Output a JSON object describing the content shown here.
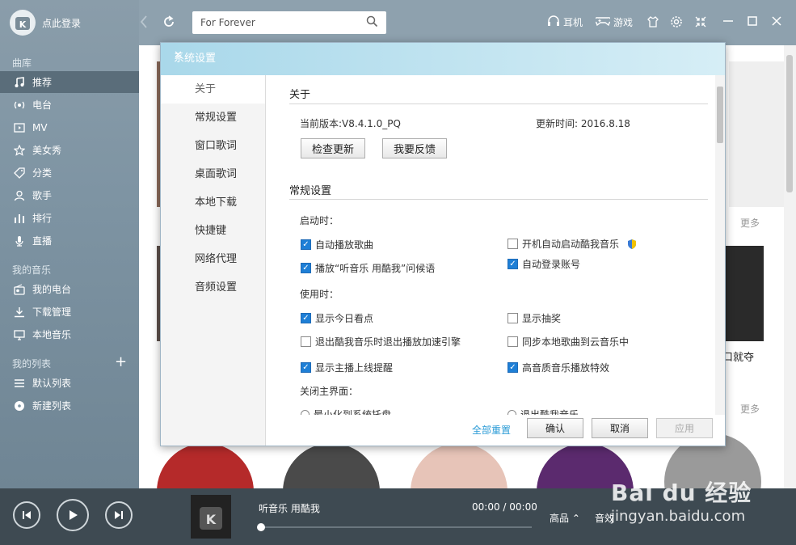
{
  "sidebar": {
    "login_label": "点此登录",
    "sections": [
      {
        "title": "曲库",
        "items": [
          {
            "label": "推荐",
            "icon": "music-note-icon",
            "active": true
          },
          {
            "label": "电台",
            "icon": "radio-icon"
          },
          {
            "label": "MV",
            "icon": "mv-icon"
          },
          {
            "label": "美女秀",
            "icon": "star-icon"
          },
          {
            "label": "分类",
            "icon": "tag-icon"
          },
          {
            "label": "歌手",
            "icon": "person-icon"
          },
          {
            "label": "排行",
            "icon": "bars-icon"
          },
          {
            "label": "直播",
            "icon": "mic-icon"
          }
        ]
      },
      {
        "title": "我的音乐",
        "items": [
          {
            "label": "我的电台",
            "icon": "radio-box-icon"
          },
          {
            "label": "下载管理",
            "icon": "download-icon"
          },
          {
            "label": "本地音乐",
            "icon": "monitor-icon"
          }
        ]
      },
      {
        "title": "我的列表",
        "items": [
          {
            "label": "默认列表",
            "icon": "list-icon"
          },
          {
            "label": "新建列表",
            "icon": "disc-icon"
          }
        ]
      }
    ]
  },
  "topbar": {
    "search_value": "For Forever",
    "earphone_label": "耳机",
    "game_label": "游戏"
  },
  "main": {
    "more_1": "更多",
    "more_2": "更多",
    "side_text": "口就夺"
  },
  "dialog": {
    "title": "系统设置",
    "nav": [
      "关于",
      "常规设置",
      "窗口歌词",
      "桌面歌词",
      "本地下载",
      "快捷键",
      "网络代理",
      "音频设置"
    ],
    "about": {
      "heading": "关于",
      "version": "当前版本:V8.4.1.0_PQ",
      "update_time": "更新时间: 2016.8.18",
      "check_update": "检查更新",
      "feedback": "我要反馈"
    },
    "general": {
      "heading": "常规设置",
      "on_start": "启动时：",
      "auto_play": "自动播放歌曲",
      "auto_start": "开机自动启动酷我音乐",
      "play_greeting": "播放“听音乐 用酷我”问候语",
      "auto_login": "自动登录账号",
      "on_use": "使用时：",
      "show_today": "显示今日看点",
      "show_lottery": "显示抽奖",
      "exit_accel": "退出酷我音乐时退出播放加速引擎",
      "sync_cloud": "同步本地歌曲到云音乐中",
      "show_anchor": "显示主播上线提醒",
      "hq_effect": "高音质音乐播放特效",
      "on_close": "关闭主界面：",
      "minimize_tray": "最小化到系统托盘",
      "exit_app": "退出酷我音乐"
    },
    "footer": {
      "reset_all": "全部重置",
      "ok": "确认",
      "cancel": "取消",
      "apply": "应用"
    }
  },
  "player": {
    "title": "听音乐 用酷我",
    "time": "00:00 / 00:00",
    "quality": "高品",
    "effect": "音效",
    "progress": 0
  },
  "watermark": {
    "brand": "Bai du 经验",
    "url": "jingyan.baidu.com"
  }
}
